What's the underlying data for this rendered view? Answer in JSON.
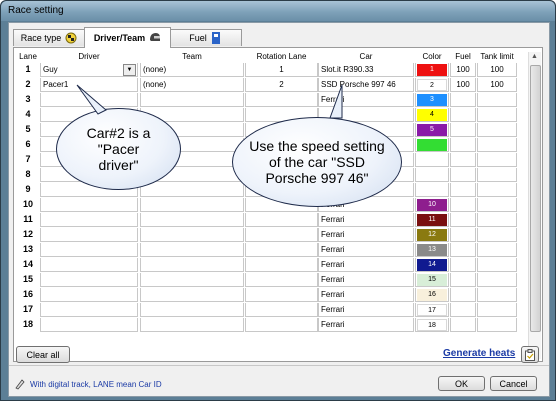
{
  "window": {
    "title": "Race setting"
  },
  "tabs": [
    {
      "label": "Race type",
      "icon": "checkered-flag-icon"
    },
    {
      "label": "Driver/Team",
      "icon": "driver-helmet-icon"
    },
    {
      "label": "Fuel",
      "icon": "fuel-pump-icon"
    }
  ],
  "table": {
    "headers": {
      "lane": "Lane",
      "driver": "Driver",
      "team": "Team",
      "rotation": "Rotation Lane",
      "car": "Car",
      "color": "Color",
      "fuel": "Fuel",
      "tank": "Tank limit"
    },
    "rows": [
      {
        "lane": "1",
        "driver": "Guy",
        "team": "(none)",
        "rotation": "1",
        "car": "Slot.it R390.33",
        "color_label": "1",
        "color": "#ee1111",
        "text_color": "#ffffff",
        "fuel": "100",
        "tank": "100"
      },
      {
        "lane": "2",
        "driver": "Pacer1",
        "team": "(none)",
        "rotation": "2",
        "car": "SSD Porsche 997 46",
        "color_label": "2",
        "color": "#ffffff",
        "text_color": "#000000",
        "fuel": "100",
        "tank": "100"
      },
      {
        "lane": "3",
        "driver": "",
        "team": "",
        "rotation": "",
        "car": "Ferrari",
        "color_label": "3",
        "color": "#1e90ff",
        "text_color": "#ffffff",
        "fuel": "",
        "tank": ""
      },
      {
        "lane": "4",
        "driver": "",
        "team": "",
        "rotation": "",
        "car": "",
        "color_label": "4",
        "color": "#ffff00",
        "text_color": "#000000",
        "fuel": "",
        "tank": ""
      },
      {
        "lane": "5",
        "driver": "",
        "team": "",
        "rotation": "",
        "car": "",
        "color_label": "5",
        "color": "#8a1aa8",
        "text_color": "#ffffff",
        "fuel": "",
        "tank": ""
      },
      {
        "lane": "6",
        "driver": "",
        "team": "",
        "rotation": "",
        "car": "",
        "color_label": "",
        "color": "#33dd33",
        "text_color": "#000000",
        "fuel": "",
        "tank": ""
      },
      {
        "lane": "7",
        "driver": "",
        "team": "",
        "rotation": "",
        "car": "",
        "color_label": "",
        "color": "",
        "text_color": "#000000",
        "fuel": "",
        "tank": ""
      },
      {
        "lane": "8",
        "driver": "",
        "team": "",
        "rotation": "",
        "car": "",
        "color_label": "",
        "color": "",
        "text_color": "#000000",
        "fuel": "",
        "tank": ""
      },
      {
        "lane": "9",
        "driver": "",
        "team": "",
        "rotation": "",
        "car": "",
        "color_label": "",
        "color": "",
        "text_color": "#000000",
        "fuel": "",
        "tank": ""
      },
      {
        "lane": "10",
        "driver": "",
        "team": "",
        "rotation": "",
        "car": "Ferrari",
        "color_label": "10",
        "color": "#8e1e8e",
        "text_color": "#ffffff",
        "fuel": "",
        "tank": ""
      },
      {
        "lane": "11",
        "driver": "",
        "team": "",
        "rotation": "",
        "car": "Ferrari",
        "color_label": "11",
        "color": "#7a1010",
        "text_color": "#ffffff",
        "fuel": "",
        "tank": ""
      },
      {
        "lane": "12",
        "driver": "",
        "team": "",
        "rotation": "",
        "car": "Ferrari",
        "color_label": "12",
        "color": "#8a7a10",
        "text_color": "#ffffff",
        "fuel": "",
        "tank": ""
      },
      {
        "lane": "13",
        "driver": "",
        "team": "",
        "rotation": "",
        "car": "Ferrari",
        "color_label": "13",
        "color": "#8a8a8a",
        "text_color": "#ffffff",
        "fuel": "",
        "tank": ""
      },
      {
        "lane": "14",
        "driver": "",
        "team": "",
        "rotation": "",
        "car": "Ferrari",
        "color_label": "14",
        "color": "#101a90",
        "text_color": "#ffffff",
        "fuel": "",
        "tank": ""
      },
      {
        "lane": "15",
        "driver": "",
        "team": "",
        "rotation": "",
        "car": "Ferrari",
        "color_label": "15",
        "color": "#d8eed8",
        "text_color": "#000000",
        "fuel": "",
        "tank": ""
      },
      {
        "lane": "16",
        "driver": "",
        "team": "",
        "rotation": "",
        "car": "Ferrari",
        "color_label": "16",
        "color": "#f8f0dc",
        "text_color": "#000000",
        "fuel": "",
        "tank": ""
      },
      {
        "lane": "17",
        "driver": "",
        "team": "",
        "rotation": "",
        "car": "Ferrari",
        "color_label": "17",
        "color": "#ffffff",
        "text_color": "#000000",
        "fuel": "",
        "tank": ""
      },
      {
        "lane": "18",
        "driver": "",
        "team": "",
        "rotation": "",
        "car": "Ferrari",
        "color_label": "18",
        "color": "#ffffff",
        "text_color": "#000000",
        "fuel": "",
        "tank": ""
      }
    ]
  },
  "callouts": {
    "pacer": [
      "Car#2 is a",
      "\"Pacer",
      "driver\""
    ],
    "speed": [
      "Use the speed setting",
      "of the car \"SSD",
      "Porsche 997 46\""
    ]
  },
  "buttons": {
    "clear_all": "Clear all",
    "generate_heats": "Generate heats",
    "ok": "OK",
    "cancel": "Cancel"
  },
  "hint": {
    "text": "With digital track, LANE mean Car ID",
    "icon": "info-icon"
  }
}
